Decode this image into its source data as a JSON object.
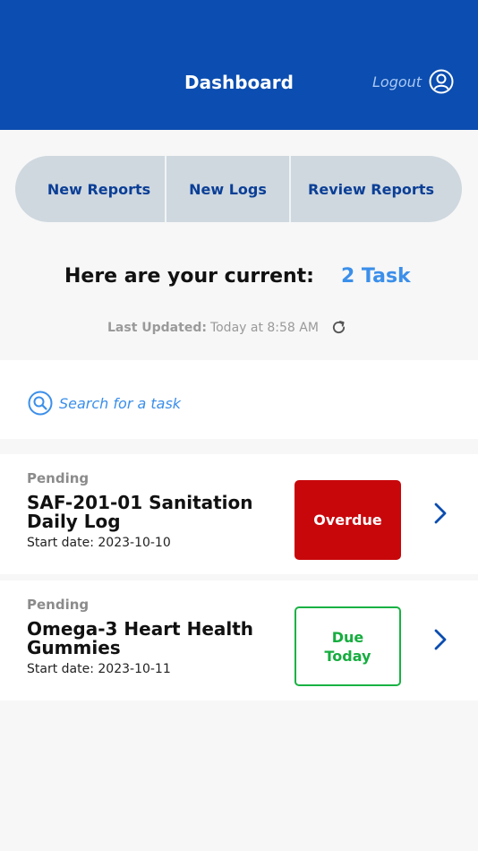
{
  "header": {
    "title": "Dashboard",
    "logout_label": "Logout",
    "user_icon": "user-circle-icon",
    "color": "#0b4db0"
  },
  "nav": {
    "tabs": [
      {
        "label": "New Reports"
      },
      {
        "label": "New Logs"
      },
      {
        "label": "Review Reports"
      }
    ]
  },
  "summary": {
    "label": "Here are your current:",
    "count_text": "2 Task",
    "updated_label": "Last Updated:",
    "updated_value": "Today at 8:58 AM",
    "refresh_icon": "refresh-icon"
  },
  "search": {
    "placeholder": "Search for a task",
    "icon": "search-icon"
  },
  "tasks": [
    {
      "status": "Pending",
      "title": "SAF-201-01 Sanitation Daily Log",
      "start_date": "Start date: 2023-10-10",
      "badge": "Overdue",
      "badge_color": "#c8070b"
    },
    {
      "status": "Pending",
      "title": "Omega-3 Heart Health Gummies",
      "start_date": "Start date: 2023-10-11",
      "badge": "Due Today",
      "badge_color": "#19b243"
    }
  ],
  "colors": {
    "accent": "#3b8fea",
    "tab_text": "#0b3f96",
    "tab_background": "#cfd8df"
  }
}
